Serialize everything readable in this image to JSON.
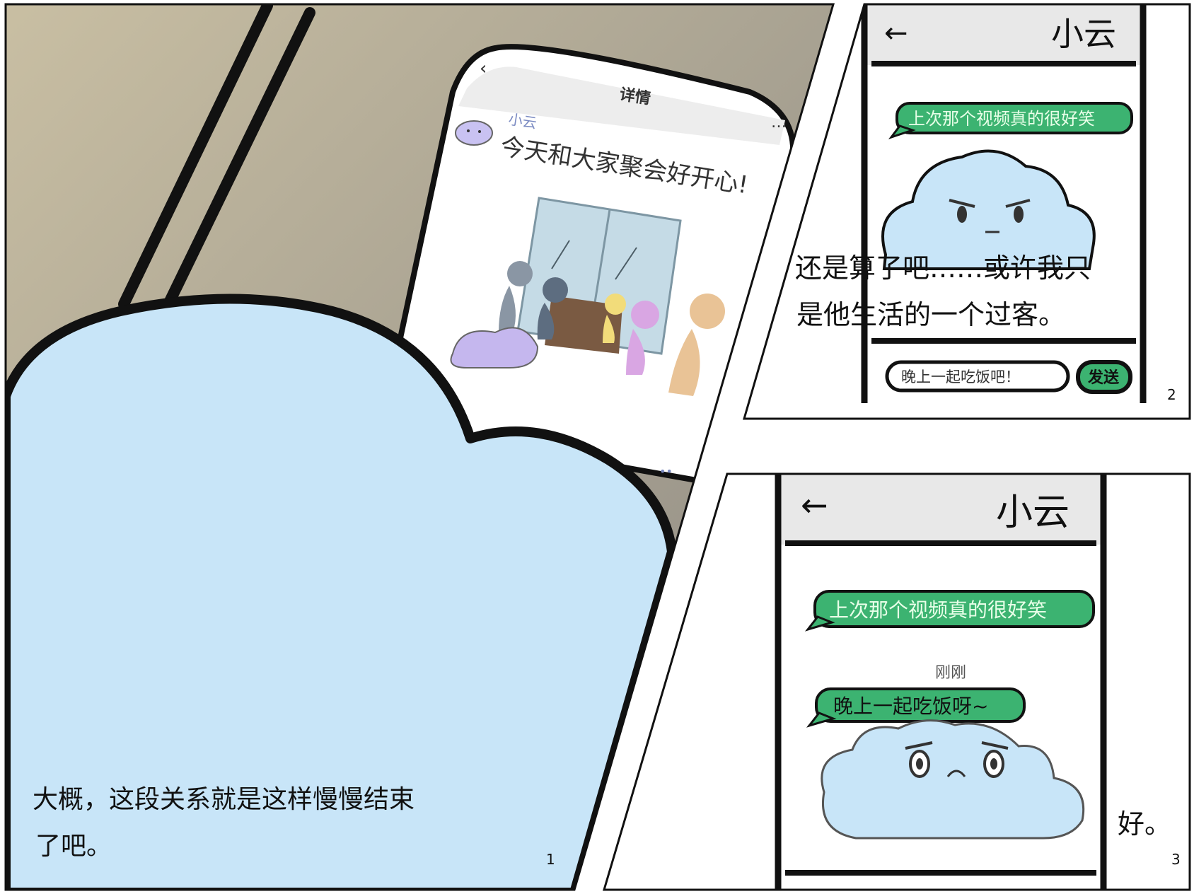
{
  "panel1": {
    "phone_header": "详情",
    "post_author": "小云",
    "post_text": "今天和大家聚会好开心!",
    "more_icon": "more-dots-icon",
    "narration_line1": "大概，这段关系就是这样慢慢结束",
    "narration_line2": "了吧。",
    "page_number": "1"
  },
  "panel2": {
    "chat_title": "小云",
    "sent_message": "上次那个视频真的很好笑",
    "narration_line1": "还是算了吧……或许我只",
    "narration_line2": "是他生活的一个过客。",
    "input_value": "晚上一起吃饭吧！",
    "send_button": "发送",
    "page_number": "2"
  },
  "panel3": {
    "chat_title": "小云",
    "sent_message": "上次那个视频真的很好笑",
    "timestamp": "刚刚",
    "sent_message_2": "晚上一起吃饭呀~",
    "narration": "好。",
    "page_number": "3"
  },
  "colors": {
    "cloud_blue": "#c8e5f8",
    "bubble_green": "#3cb371",
    "ink": "#111111",
    "room_wall": "#a09a8c"
  }
}
